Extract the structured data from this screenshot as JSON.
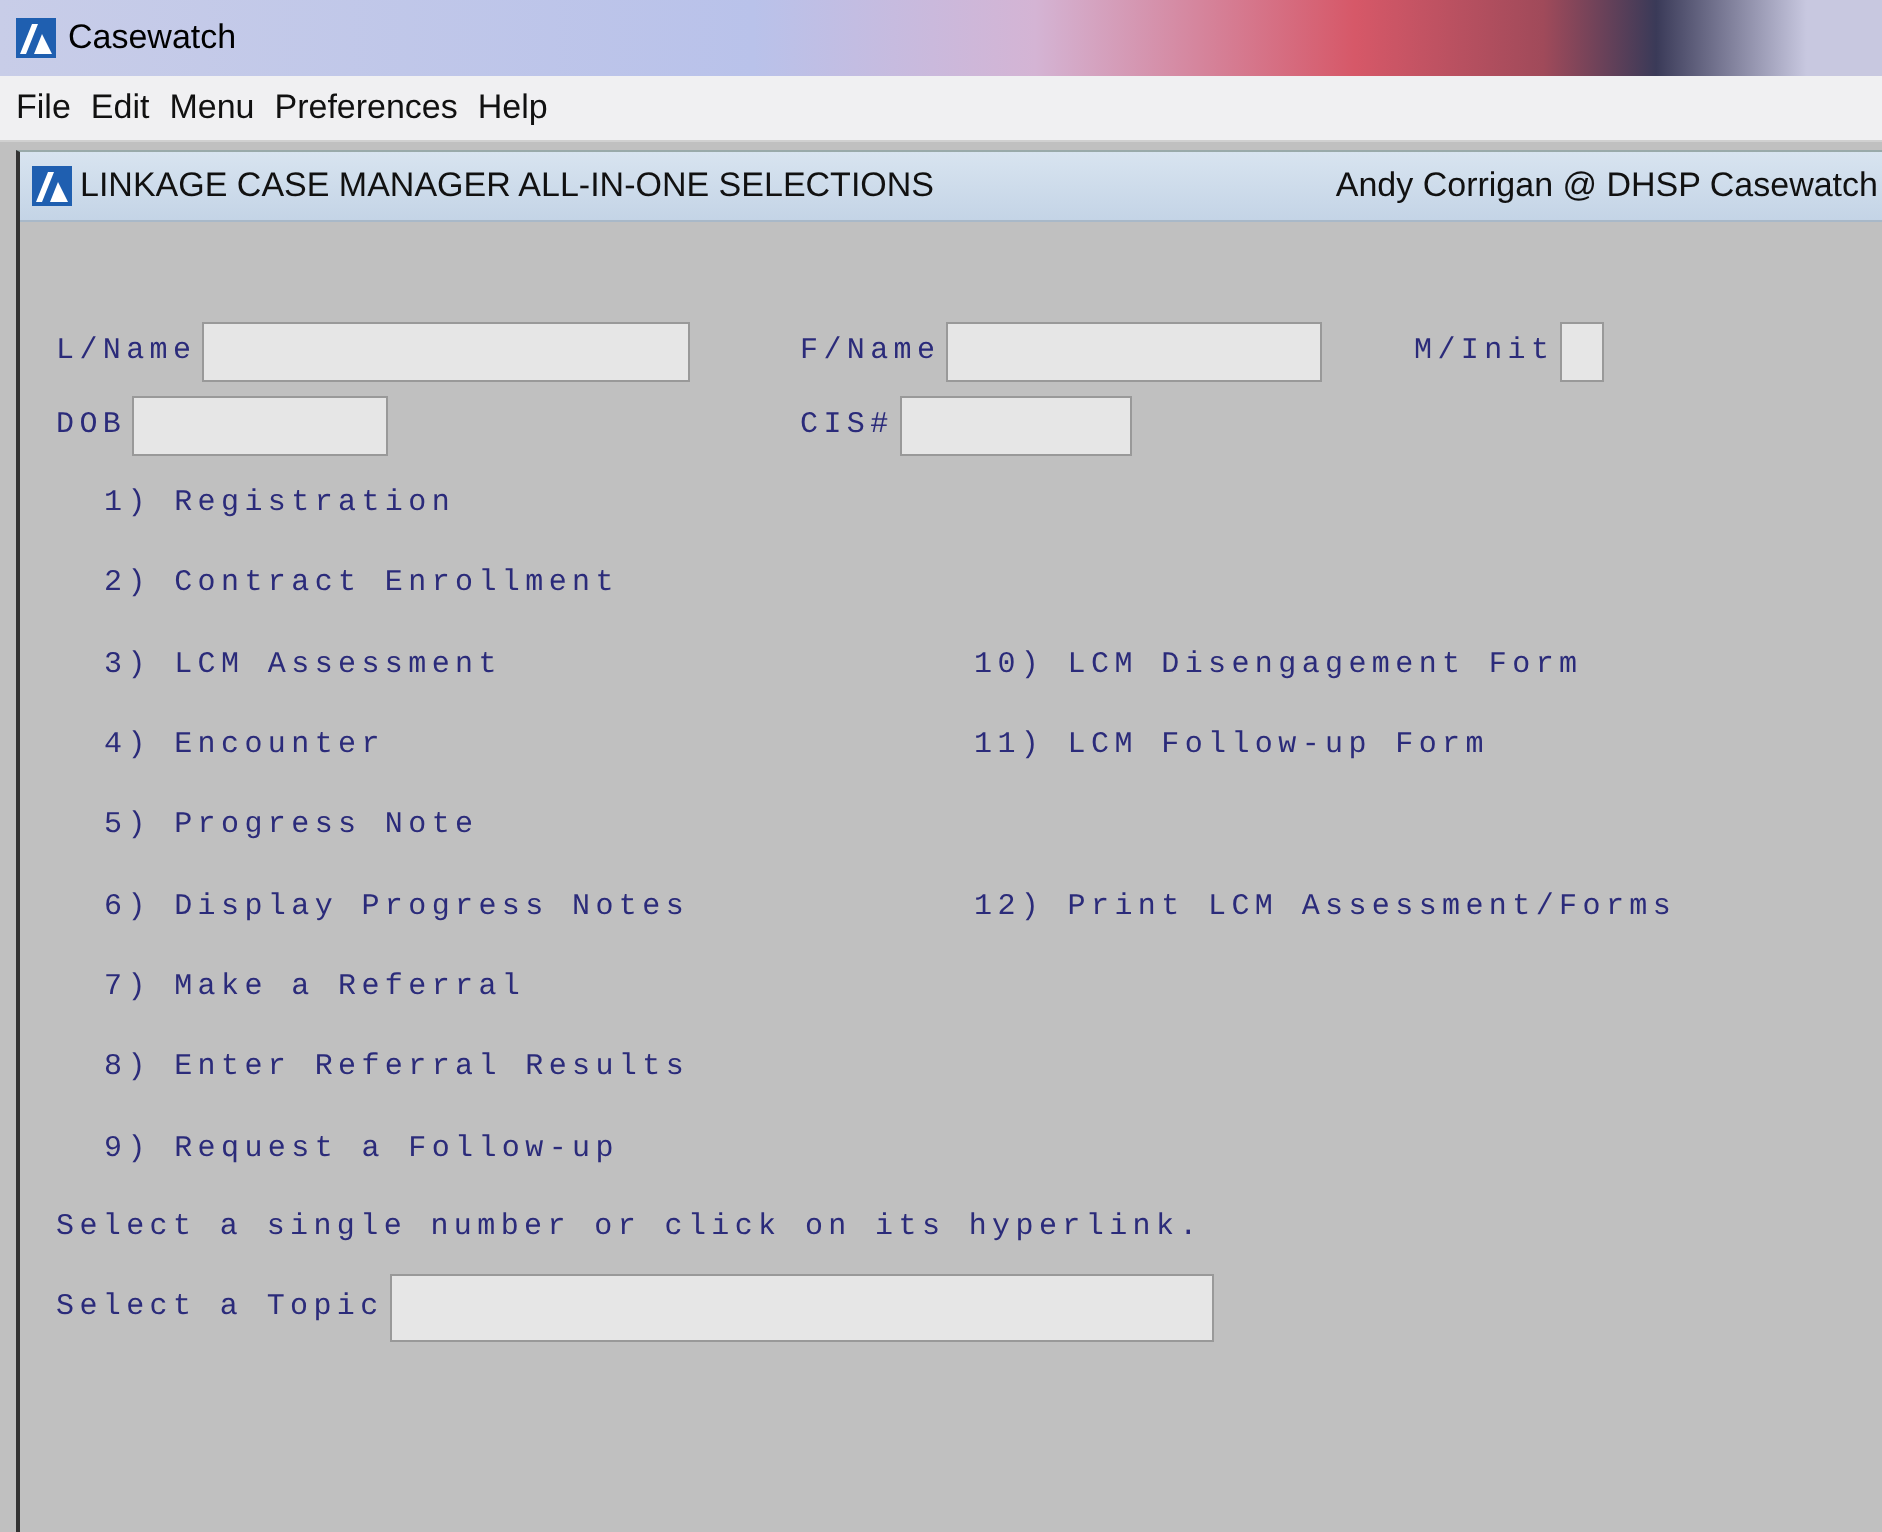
{
  "window": {
    "title": "Casewatch"
  },
  "menu_bar": [
    "File",
    "Edit",
    "Menu",
    "Preferences",
    "Help"
  ],
  "form": {
    "title": "LINKAGE CASE MANAGER ALL-IN-ONE SELECTIONS",
    "user": "Andy Corrigan @ DHSP Casewatch",
    "field_rows": [
      {
        "fields": [
          {
            "label": "L/Name"
          },
          {
            "label": "F/Name"
          },
          {
            "label": "M/Init"
          }
        ]
      },
      {
        "fields": [
          {
            "label": "DOB"
          },
          {
            "label": "CIS#"
          }
        ]
      }
    ],
    "option_rows": [
      {
        "left": "1) Registration"
      },
      {
        "left": "2) Contract Enrollment"
      },
      {
        "left": "3) LCM Assessment",
        "right": "10) LCM Disengagement Form"
      },
      {
        "left": "4) Encounter",
        "right": "11) LCM Follow-up Form"
      },
      {
        "left": "5) Progress Note"
      },
      {
        "left": "6) Display Progress Notes",
        "right": "12) Print LCM Assessment/Forms"
      },
      {
        "left": "7) Make a Referral"
      },
      {
        "left": "8) Enter Referral Results"
      },
      {
        "left": "9) Request a Follow-up"
      }
    ],
    "instruction": "Select a single number or click on its hyperlink.",
    "topic_label": "Select a Topic"
  }
}
